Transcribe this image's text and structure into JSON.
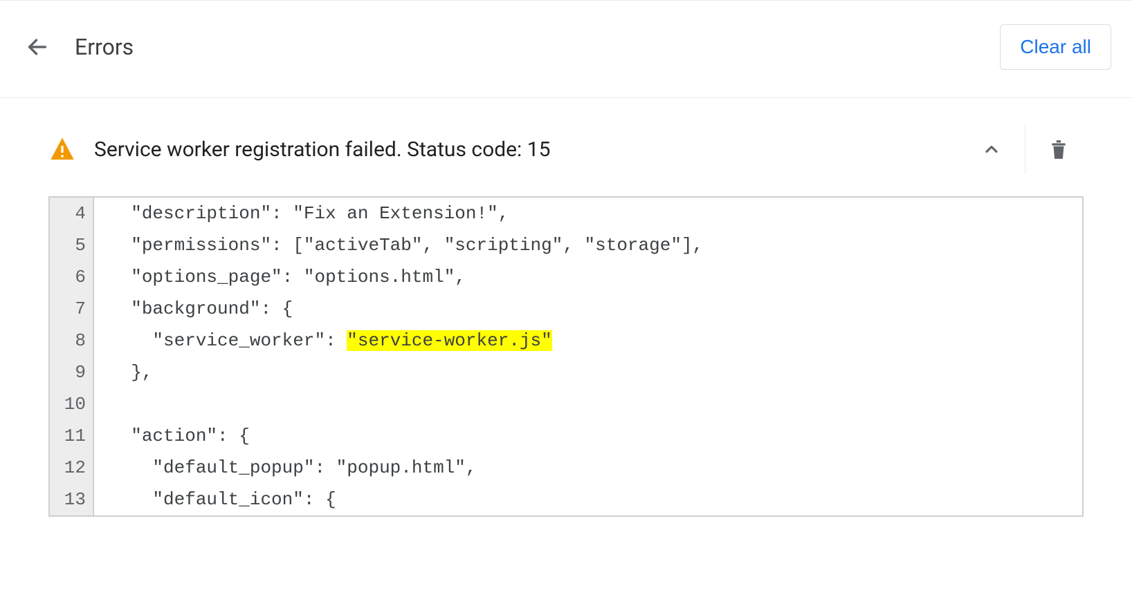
{
  "header": {
    "title": "Errors",
    "clear_all_label": "Clear all"
  },
  "error": {
    "message": "Service worker registration failed. Status code: 15",
    "highlight_line": 8,
    "highlight_text": "\"service-worker.js\"",
    "lines": [
      {
        "n": 4,
        "indent": "  ",
        "pre": "\"description\": \"Fix an Extension!\",",
        "hl": "",
        "post": ""
      },
      {
        "n": 5,
        "indent": "  ",
        "pre": "\"permissions\": [\"activeTab\", \"scripting\", \"storage\"],",
        "hl": "",
        "post": ""
      },
      {
        "n": 6,
        "indent": "  ",
        "pre": "\"options_page\": \"options.html\",",
        "hl": "",
        "post": ""
      },
      {
        "n": 7,
        "indent": "  ",
        "pre": "\"background\": {",
        "hl": "",
        "post": ""
      },
      {
        "n": 8,
        "indent": "    ",
        "pre": "\"service_worker\": ",
        "hl": "\"service-worker.js\"",
        "post": ""
      },
      {
        "n": 9,
        "indent": "  ",
        "pre": "},",
        "hl": "",
        "post": ""
      },
      {
        "n": 10,
        "indent": "",
        "pre": "",
        "hl": "",
        "post": ""
      },
      {
        "n": 11,
        "indent": "  ",
        "pre": "\"action\": {",
        "hl": "",
        "post": ""
      },
      {
        "n": 12,
        "indent": "    ",
        "pre": "\"default_popup\": \"popup.html\",",
        "hl": "",
        "post": ""
      },
      {
        "n": 13,
        "indent": "    ",
        "pre": "\"default_icon\": {",
        "hl": "",
        "post": ""
      }
    ]
  }
}
